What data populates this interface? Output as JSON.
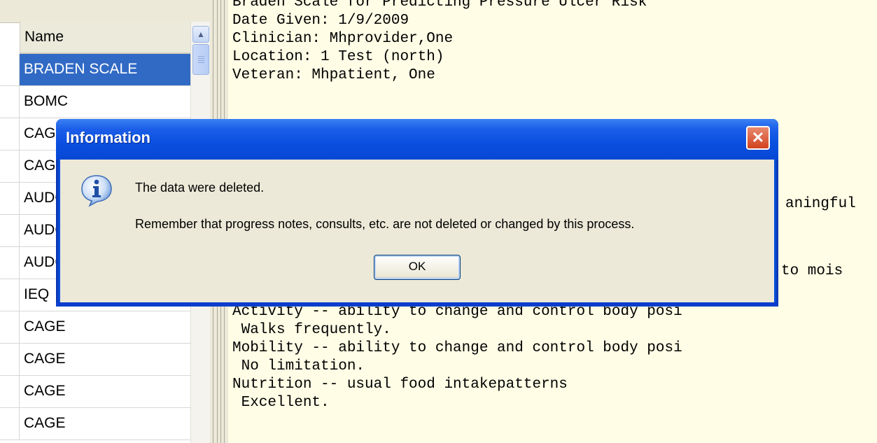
{
  "list": {
    "header": "Name",
    "rows": [
      {
        "name": "BRADEN SCALE",
        "selected": true
      },
      {
        "name": "BOMC"
      },
      {
        "name": "CAGE"
      },
      {
        "name": "CAGE"
      },
      {
        "name": "AUDC"
      },
      {
        "name": "AUDC"
      },
      {
        "name": "AUDC"
      },
      {
        "name": "IEQ"
      },
      {
        "name": "CAGE"
      },
      {
        "name": "CAGE"
      },
      {
        "name": "CAGE"
      },
      {
        "name": "CAGE"
      }
    ]
  },
  "report": {
    "lines": [
      "Braden Scale for Predicting Pressure Ulcer Risk",
      "Date Given: 1/9/2009",
      "Clinician: Mhprovider,One",
      "Location: 1 Test (north)",
      "Veteran: Mhpatient, One",
      "",
      "",
      "",
      "",
      "",
      "",
      "",
      "",
      "",
      "",
      "",
      "",
      "Activity -- ability to change and control body posi",
      " Walks frequently.",
      "Mobility -- ability to change and control body posi",
      " No limitation.",
      "Nutrition -- usual food intakepatterns",
      " Excellent."
    ],
    "partial_right_1": "aningful",
    "partial_right_2": "to mois"
  },
  "dialog": {
    "title": "Information",
    "message_line1": "The data were deleted.",
    "message_line2": "Remember that progress notes, consults, etc. are not deleted or changed by this process.",
    "ok_label": "OK",
    "close_glyph": "✕"
  },
  "colors": {
    "selection": "#316ac5",
    "report_background": "#fffde6",
    "title_bar": "#0a4fe0",
    "close_button": "#d2421d"
  }
}
